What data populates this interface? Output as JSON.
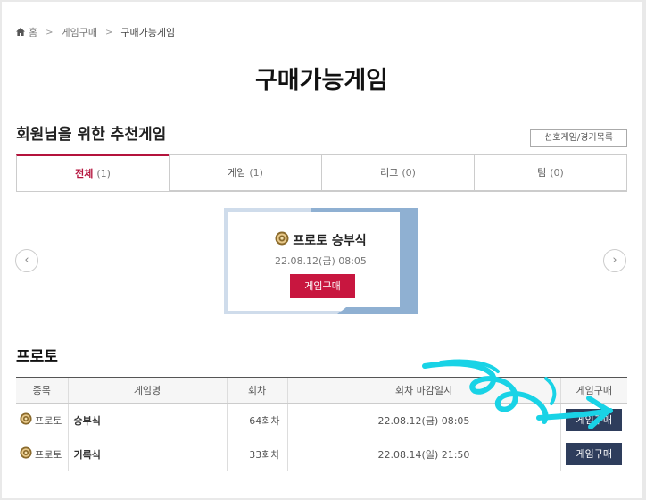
{
  "breadcrumb": {
    "home": "홈",
    "parent": "게임구매",
    "current": "구매가능게임"
  },
  "page_title": "구매가능게임",
  "recommend": {
    "heading": "회원님을 위한 추천게임",
    "pref_button": "선호게임/경기목록",
    "tabs": [
      {
        "label": "전체",
        "count": "(1)",
        "active": true
      },
      {
        "label": "게임",
        "count": "(1)"
      },
      {
        "label": "리그",
        "count": "(0)"
      },
      {
        "label": "팀",
        "count": "(0)"
      }
    ],
    "card": {
      "title": "프로토 승부식",
      "date": "22.08.12(금) 08:05",
      "buy_label": "게임구매"
    },
    "prev_icon": "chevron-left-icon",
    "next_icon": "chevron-right-icon"
  },
  "proto": {
    "heading": "프로토",
    "columns": [
      "종목",
      "게임명",
      "회차",
      "회차 마감일시",
      "게임구매"
    ],
    "rows": [
      {
        "sport": "프로토",
        "name": "승부식",
        "round": "64회차",
        "deadline": "22.08.12(금) 08:05",
        "buy": "게임구매"
      },
      {
        "sport": "프로토",
        "name": "기록식",
        "round": "33회차",
        "deadline": "22.08.14(일) 21:50",
        "buy": "게임구매"
      }
    ]
  },
  "colors": {
    "accent_red": "#c8163f",
    "tab_red": "#b4133c",
    "navy_button": "#2e3d5c",
    "annotation_cyan": "#19d3e6"
  }
}
